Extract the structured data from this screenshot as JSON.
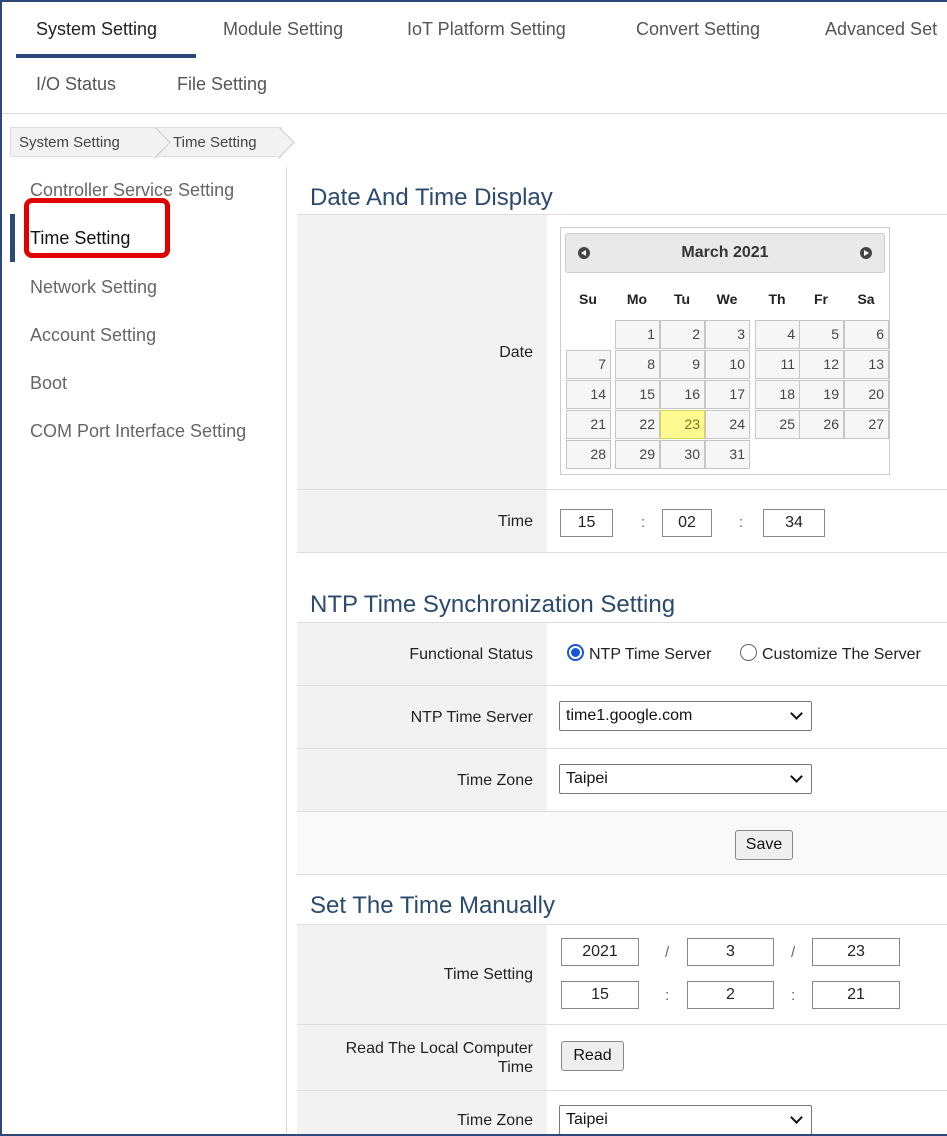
{
  "top_tabs": [
    "System Setting",
    "Module Setting",
    "IoT Platform Setting",
    "Convert Setting",
    "Advanced Set",
    "I/O Status",
    "File Setting"
  ],
  "breadcrumb": [
    "System Setting",
    "Time Setting"
  ],
  "sidebar": [
    "Controller Service Setting",
    "Time Setting",
    "Network Setting",
    "Account Setting",
    "Boot",
    "COM Port Interface Setting"
  ],
  "date_time_display": {
    "title": "Date And Time Display",
    "date_label": "Date",
    "time_label": "Time",
    "calendar": {
      "month_label": "March 2021",
      "weekdays": [
        "Su",
        "Mo",
        "Tu",
        "We",
        "Th",
        "Fr",
        "Sa"
      ],
      "days": [
        "1",
        "2",
        "3",
        "4",
        "5",
        "6",
        "7",
        "8",
        "9",
        "10",
        "11",
        "12",
        "13",
        "14",
        "15",
        "16",
        "17",
        "18",
        "19",
        "20",
        "21",
        "22",
        "23",
        "24",
        "25",
        "26",
        "27",
        "28",
        "29",
        "30",
        "31"
      ],
      "selected_day": "23"
    },
    "time": {
      "hour": "15",
      "minute": "02",
      "second": "34",
      "sep": ":"
    }
  },
  "ntp": {
    "title": "NTP Time Synchronization Setting",
    "functional_status_label": "Functional Status",
    "option_ntp": "NTP Time Server",
    "option_custom": "Customize The Server",
    "server_label": "NTP Time Server",
    "server_value": "time1.google.com",
    "timezone_label": "Time Zone",
    "timezone_value": "Taipei",
    "save_label": "Save"
  },
  "manual": {
    "title": "Set The Time Manually",
    "time_setting_label": "Time Setting",
    "year": "2021",
    "month": "3",
    "day": "23",
    "hour": "15",
    "minute": "2",
    "second": "21",
    "date_sep": "/",
    "time_sep": ":",
    "read_label": "Read The Local Computer Time",
    "read_button": "Read",
    "timezone_label": "Time Zone",
    "timezone_value": "Taipei"
  }
}
